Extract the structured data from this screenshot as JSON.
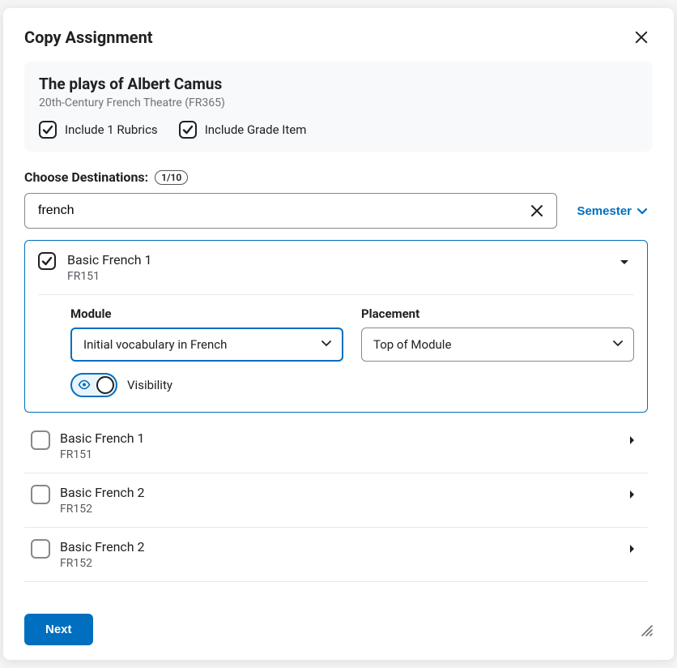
{
  "dialog": {
    "title": "Copy Assignment"
  },
  "source": {
    "title": "The plays of Albert Camus",
    "subtitle": "20th-Century French Theatre (FR365)",
    "include_rubrics_label": "Include 1 Rubrics",
    "include_grade_label": "Include Grade Item"
  },
  "destinations_header": {
    "label": "Choose Destinations:",
    "count": "1/10"
  },
  "search": {
    "value": "french",
    "semester_label": "Semester"
  },
  "expanded_destination": {
    "name": "Basic French 1",
    "code": "FR151",
    "module_label": "Module",
    "module_value": "Initial vocabulary in French",
    "placement_label": "Placement",
    "placement_value": "Top of Module",
    "visibility_label": "Visibility"
  },
  "other_destinations": [
    {
      "name": "Basic French 1",
      "code": "FR151"
    },
    {
      "name": "Basic French 2",
      "code": "FR152"
    },
    {
      "name": "Basic French 2",
      "code": "FR152"
    }
  ],
  "footer": {
    "next_label": "Next"
  }
}
